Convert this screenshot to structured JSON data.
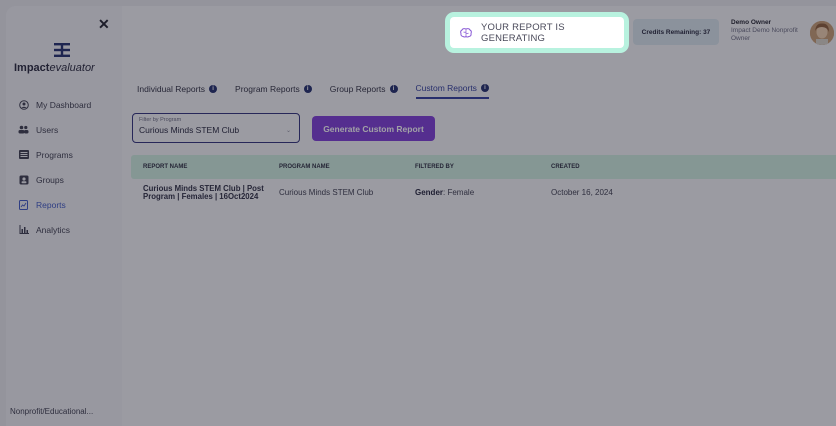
{
  "sidebar": {
    "logo_prefix": "Impact",
    "logo_suffix": "evaluator",
    "items": [
      {
        "label": "My Dashboard",
        "icon": "user-circle-icon"
      },
      {
        "label": "Users",
        "icon": "users-icon"
      },
      {
        "label": "Programs",
        "icon": "list-icon"
      },
      {
        "label": "Groups",
        "icon": "group-box-icon"
      },
      {
        "label": "Reports",
        "icon": "report-icon"
      },
      {
        "label": "Analytics",
        "icon": "bar-chart-icon"
      }
    ],
    "footer": "Nonprofit/Educational..."
  },
  "header": {
    "toast_text": "YOUR REPORT IS GENERATING",
    "credits": "Credits Remaining: 37",
    "user_name": "Demo  Owner",
    "user_org": "Impact Demo Nonprofit",
    "user_role": "Owner"
  },
  "tabs": [
    {
      "label": "Individual Reports"
    },
    {
      "label": "Program Reports"
    },
    {
      "label": "Group Reports"
    },
    {
      "label": "Custom Reports"
    }
  ],
  "filter": {
    "label": "Filter by Program",
    "value": "Curious Minds STEM Club"
  },
  "generate_button": "Generate Custom Report",
  "table": {
    "headers": [
      "REPORT NAME",
      "PROGRAM NAME",
      "FILTERED BY",
      "CREATED"
    ],
    "rows": [
      {
        "report_name": "Curious Minds STEM Club | Post Program | Females | 16Oct2024",
        "program_name": "Curious Minds STEM Club",
        "filtered_by_key": "Gender",
        "filtered_by_value": ": Female",
        "created": "October 16, 2024"
      }
    ]
  },
  "colors": {
    "accent_purple": "#7d3ad8",
    "highlight_mint": "#b8f2df",
    "table_header": "#cfeee0",
    "active_tab": "#2d3a9b"
  }
}
